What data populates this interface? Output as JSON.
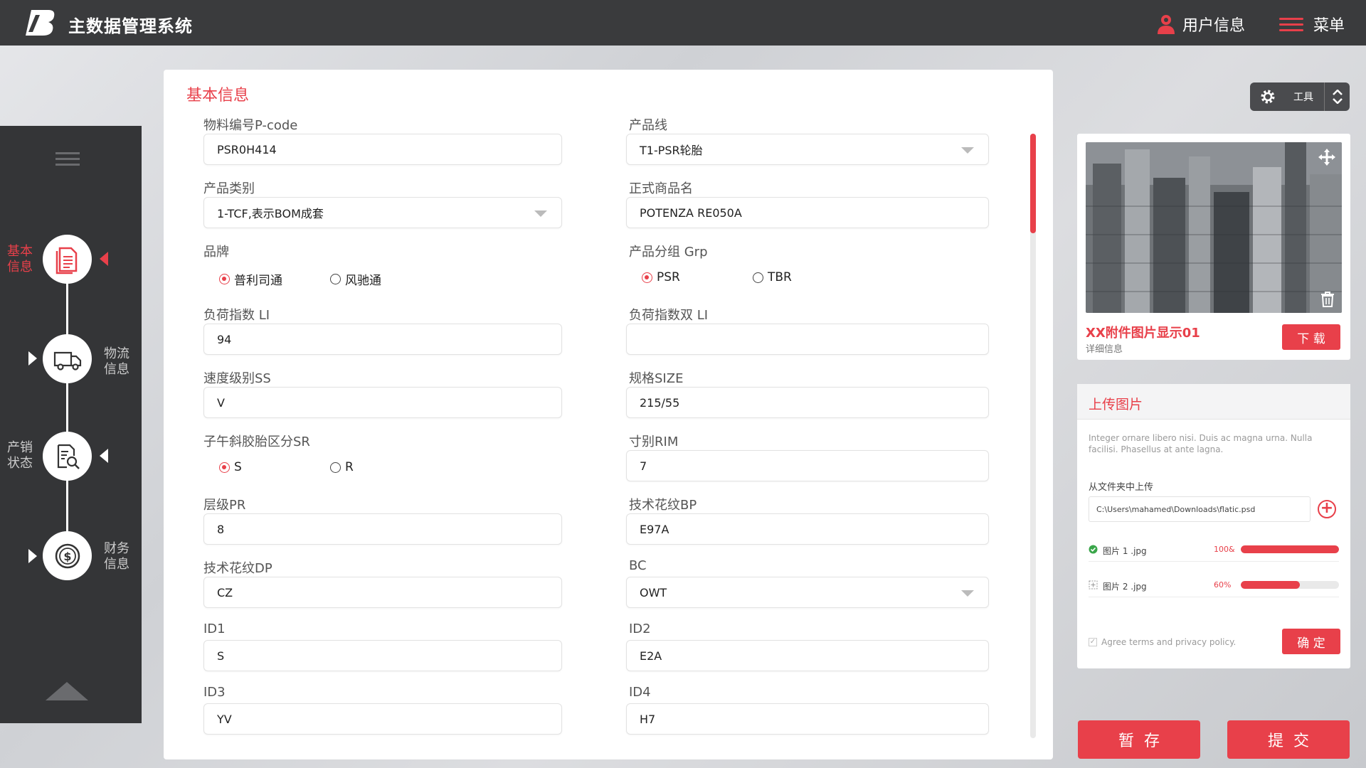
{
  "header": {
    "title": "主数据管理系统",
    "user_info": "用户信息",
    "menu": "菜单"
  },
  "leftnav": {
    "items": [
      {
        "label": "基本信息",
        "label_lines": [
          "基本",
          "信息"
        ],
        "icon": "document-icon",
        "active": true
      },
      {
        "label": "物流信息",
        "label_lines": [
          "物流",
          "信息"
        ],
        "icon": "truck-icon",
        "active": false
      },
      {
        "label": "产销状态",
        "label_lines": [
          "产销",
          "状态"
        ],
        "icon": "search-document-icon",
        "active": false
      },
      {
        "label": "财务信息",
        "label_lines": [
          "财务",
          "信息"
        ],
        "icon": "dollar-icon",
        "active": false
      }
    ]
  },
  "form": {
    "title": "基本信息",
    "left": [
      {
        "label": "物料编号P-code",
        "value": "PSR0H414",
        "type": "text"
      },
      {
        "label": "产品类别",
        "value": "1-TCF,表示BOM成套",
        "type": "select"
      },
      {
        "label": "品牌",
        "type": "radio",
        "options": [
          "普利司通",
          "风驰通"
        ],
        "selected": "普利司通"
      },
      {
        "label": "负荷指数 LI",
        "value": "94",
        "type": "text"
      },
      {
        "label": "速度级别SS",
        "value": "V",
        "type": "text"
      },
      {
        "label": "子午斜胶胎区分SR",
        "type": "radio",
        "options": [
          "S",
          "R"
        ],
        "selected": "S"
      },
      {
        "label": "层级PR",
        "value": "8",
        "type": "text"
      },
      {
        "label": "技术花纹DP",
        "value": "CZ",
        "type": "text"
      },
      {
        "label": "ID1",
        "value": "S",
        "type": "text"
      },
      {
        "label": "ID3",
        "value": "YV",
        "type": "text"
      }
    ],
    "right": [
      {
        "label": "产品线",
        "value": "T1-PSR轮胎",
        "type": "select"
      },
      {
        "label": "正式商品名",
        "value": "POTENZA RE050A",
        "type": "text"
      },
      {
        "label": "产品分组 Grp",
        "type": "radio",
        "options": [
          "PSR",
          "TBR"
        ],
        "selected": "PSR"
      },
      {
        "label": "负荷指数双 LI",
        "value": "",
        "type": "text"
      },
      {
        "label": "规格SIZE",
        "value": "215/55",
        "type": "text"
      },
      {
        "label": "寸别RIM",
        "value": "7",
        "type": "text"
      },
      {
        "label": "技术花纹BP",
        "value": "E97A",
        "type": "text"
      },
      {
        "label": "BC",
        "value": "OWT",
        "type": "select"
      },
      {
        "label": "ID2",
        "value": "E2A",
        "type": "text"
      },
      {
        "label": "ID4",
        "value": "H7",
        "type": "text"
      }
    ]
  },
  "tools": {
    "label": "工具"
  },
  "attachment": {
    "title": "XX附件图片显示01",
    "subtitle": "详细信息",
    "download": "下 载"
  },
  "upload": {
    "title": "上传图片",
    "description": "Integer ornare libero nisi. Duis ac magna urna. Nulla facilisi. Phasellus at ante lagna.",
    "from_folder": "从文件夹中上传",
    "path": "C:\\Users\\mahamed\\Downloads\\flatic.psd",
    "files": [
      {
        "name": "图片 1 .jpg",
        "percent_label": "100&",
        "progress": 1.0,
        "status": "done"
      },
      {
        "name": "图片 2 .jpg",
        "percent_label": "60%",
        "progress": 0.6,
        "status": "uploading"
      }
    ],
    "agree": "Agree terms and privacy policy.",
    "confirm": "确 定"
  },
  "actions": {
    "save": "暂存",
    "submit": "提交"
  },
  "colors": {
    "accent": "#e8404a",
    "topbar": "#3a3b3d",
    "nav": "#343537"
  }
}
